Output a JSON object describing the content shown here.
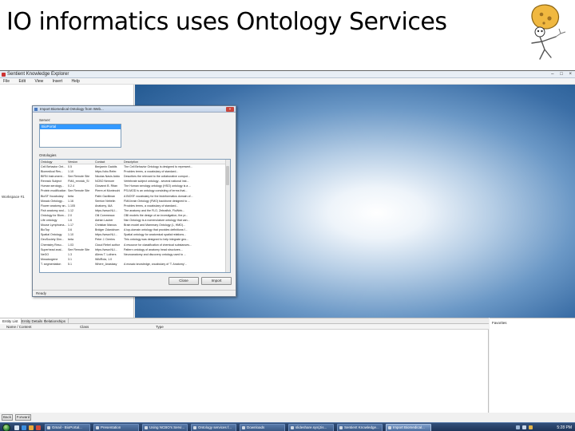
{
  "slide": {
    "title": "IO informatics uses Ontology Services"
  },
  "app": {
    "title": "Sentient Knowledge Explorer",
    "window_controls": [
      "–",
      "□",
      "×"
    ],
    "menu": [
      "File",
      "Edit",
      "View",
      "Insert",
      "Help"
    ],
    "left_pane_label": "Workspace #1"
  },
  "dialog": {
    "title": "Import Biomedical Ontology from Web...",
    "close_label": "×",
    "server_label": "Server:",
    "server_selected": "BioPortal",
    "ontologies_label": "Ontologies",
    "columns": [
      "Ontology",
      "Version",
      "Contact",
      "Description"
    ],
    "rows": [
      [
        "Cell Behavior Ont...",
        "0.5",
        "Benjamin Gaddis",
        "The Cell Behavior Ontology is designed to represent..."
      ],
      [
        "Biomedical Res...",
        "1.10",
        "https://obo.Refer.",
        "Provides terms, a vocabulary of standard..."
      ],
      [
        "BIRN Instrument...",
        "See Remote Site",
        "Nicolas Navis Addo",
        "Describes the relevant to the collaborative comput..."
      ],
      [
        "Rennick Subject",
        "FMA_rennick_Sl",
        "NCBO Nemore",
        "Vertebrate subject ontology - several national inst..."
      ],
      [
        "Human serology...",
        "0.2.4",
        "Giovanni B. Ritan",
        "The Human serology ontology (HSO) ontology is a ..."
      ],
      [
        "Protein modification",
        "See Remote Site",
        "Pierre-et Montecchi",
        "PSI-MOD is an ontology consisting of terms that..."
      ],
      [
        "BioSF Vocabulary",
        "beta",
        "Pathi Gavillman",
        "A BIOSF vocabulary for the bioinformatics domain of..."
      ],
      [
        "Mosaic Ontology...",
        "1.16",
        "Semion Nebelin",
        "FMA brain Ontology (FMO) backbone designed to ..."
      ],
      [
        "Flower anatomy an...",
        "1.105",
        "Anatomy, IAA",
        "Provides terms, a vocabulary of standard..."
      ],
      [
        "Fish anatomy and...",
        "1.12",
        "https://www.NLI...",
        "The anatomy and the FLO, Zebrafish, FloWeb..."
      ],
      [
        "Ontology for Biom...",
        "2.0",
        "Olli Commeaux",
        "OBI models the design of an investigation, the pr..."
      ],
      [
        "Life ontology",
        "1.6",
        "Adrian Lauber",
        "Nsn Ontology is a nomenclature ontology that can..."
      ],
      [
        "Mouse Lymphoma...",
        "1.17",
        "Christian Marcus",
        "Brain model and Mammary Ontology (L, HMD)..."
      ],
      [
        "BioTop",
        "3.6",
        "Bridger Zdanichom",
        "A top-domain ontology that provides definitions f..."
      ],
      [
        "Spatial Ontology",
        "1.10",
        "https://www.NLI...",
        "Spatial ontology for anatomical spatial relations..."
      ],
      [
        "GeoSociety Dim...",
        "beta",
        "Peter J. Derrins",
        "This ontology was designed to help integrate geo..."
      ],
      [
        "Chemistry Reso...",
        "1.03",
        "Cloud Rebel author",
        "A resource for classification of chemical substances..."
      ],
      [
        "Superhead anal...",
        "See Remote Site",
        "https://www.NLI...",
        "Pattern ontology of anatomy head structures..."
      ],
      [
        "NeGO",
        "1.3",
        "Allens T. Luthers",
        "Neuroanatomy and discovery ontology used to ..."
      ],
      [
        "Mosaicogene",
        "3.1",
        "WikiRola, 1.0",
        ""
      ],
      [
        "T. segmentation",
        "5.1",
        "Where_Anastasy",
        "A mosaic knowledge, vocabulary of 'T. Anatomy'..."
      ]
    ],
    "buttons": {
      "close": "Close",
      "import": "Import"
    },
    "status": "Ready"
  },
  "bottom": {
    "tabs": [
      "Entity List",
      "Entity Details",
      "Relationships"
    ],
    "columns": [
      "Name / Content",
      "Class",
      "Type"
    ],
    "right_pane_label": "Favorites",
    "back": "Back",
    "forward": "Forward"
  },
  "taskbar": {
    "items": [
      "Gmail - BioPortal...",
      "Presentation",
      "Using NCBO's Servi...",
      "Ontology services f...",
      "Downloads",
      "slideshare.sys(Jis...",
      "Sentient Knowledge...",
      "Import Biomedical..."
    ],
    "clock": "5:28 PM"
  }
}
